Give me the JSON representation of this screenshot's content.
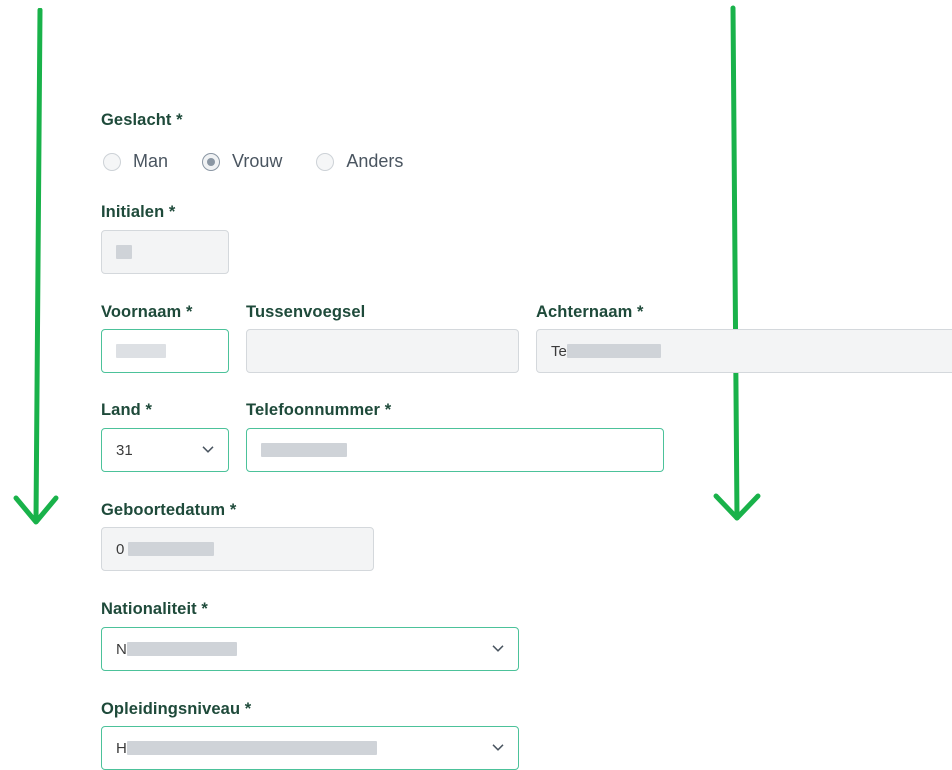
{
  "form": {
    "gender": {
      "label": "Geslacht *",
      "options": [
        {
          "label": "Man",
          "checked": false
        },
        {
          "label": "Vrouw",
          "checked": true
        },
        {
          "label": "Anders",
          "checked": false
        }
      ]
    },
    "initials": {
      "label": "Initialen *",
      "value": ""
    },
    "first_name": {
      "label": "Voornaam *",
      "value": ""
    },
    "infix": {
      "label": "Tussenvoegsel",
      "value": ""
    },
    "last_name": {
      "label": "Achternaam *",
      "value_prefix": "Te"
    },
    "country": {
      "label": "Land *",
      "value": "31"
    },
    "phone": {
      "label": "Telefoonnummer *",
      "value": ""
    },
    "birthdate": {
      "label": "Geboortedatum *",
      "value_prefix": "0"
    },
    "nationality": {
      "label": "Nationaliteit *",
      "value_prefix": "N"
    },
    "education": {
      "label": "Opleidingsniveau *",
      "value_prefix": "H"
    }
  },
  "annotations": {
    "arrow_color": "#19b24a"
  },
  "colors": {
    "label": "#1e4a3a",
    "active_border": "#4cc29a",
    "disabled_bg": "#f3f4f5"
  }
}
